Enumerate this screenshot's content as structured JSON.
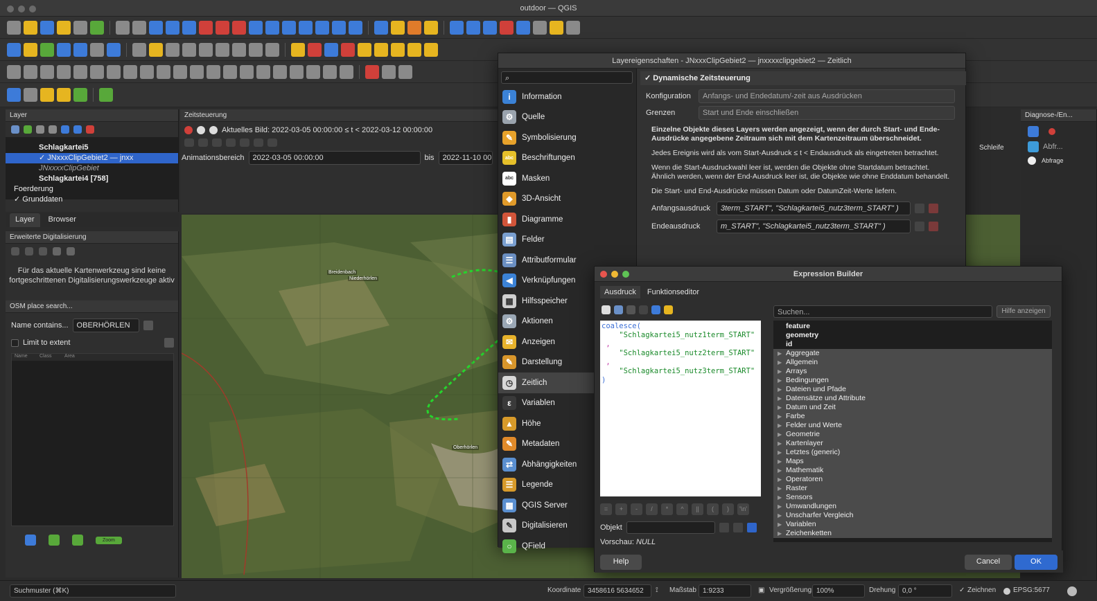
{
  "window": {
    "title": "outdoor — QGIS"
  },
  "toolbar_colors": {
    "blue": "#3d7bd9",
    "yellow": "#e6b520",
    "green": "#58a83a",
    "red": "#d0403a",
    "orange": "#e07b2a",
    "gray": "#8a8a8a"
  },
  "layer_panel": {
    "title": "Layer",
    "items": [
      {
        "label": "Schlagkartei5",
        "bold": true
      },
      {
        "label": "JNxxxClipGebiet2 — jnxx",
        "selected": true,
        "checked": "✓"
      },
      {
        "label": "JNxxxxClipGebiet",
        "italic": true
      },
      {
        "label": "Schlagkartei4 [758]",
        "bold": true
      },
      {
        "label": "Foerderung"
      },
      {
        "label": "Grunddaten",
        "checked": "✓"
      }
    ],
    "tabs": [
      "Layer",
      "Browser"
    ]
  },
  "digitizing_panel": {
    "title": "Erweiterte Digitalisierung",
    "message_line1": "Für das aktuelle Kartenwerkzeug sind keine",
    "message_line2": "fortgeschrittenen Digitalisierungswerkzeuge aktiv"
  },
  "osm_panel": {
    "title": "OSM place search...",
    "name_label": "Name contains...",
    "name_value": "OBERHÖRLEN",
    "limit_label": "Limit to extent",
    "columns": [
      "Name",
      "Class",
      "Area"
    ],
    "zoom_label": "Zoom"
  },
  "temporal_panel": {
    "title": "Zeitsteuerung",
    "current_frame": "Aktuelles Bild: 2022-03-05 00:00:00 ≤ t < 2022-03-12 00:00:00",
    "range_label": "Animationsbereich",
    "range_start": "2022-03-05 00:00:00",
    "range_to": "bis",
    "range_end": "2022-11-10 00"
  },
  "map": {
    "label_1": "Breidenbach",
    "label_2": "Oberhörlen",
    "label_3": "Niederhörlen"
  },
  "right_panel": {
    "title": "Diagnose-/En...",
    "loop_label": "Schleife",
    "search_placeholder": "Abfr...",
    "query_label": "Abfrage"
  },
  "layer_props": {
    "title": "Layereigenschaften - JNxxxClipGebiet2 — jnxxxxclipgebiet2 — Zeitlich",
    "nav": [
      {
        "label": "Information",
        "icon": "info-icon",
        "color": "#3b82d6",
        "glyph": "i"
      },
      {
        "label": "Quelle",
        "icon": "source-icon",
        "color": "#9aa3ad",
        "glyph": "⚙"
      },
      {
        "label": "Symbolisierung",
        "icon": "symbology-icon",
        "color": "#e7a22b",
        "glyph": "✎"
      },
      {
        "label": "Beschriftungen",
        "icon": "labels-icon",
        "color": "#e6c02a",
        "glyph": "abc"
      },
      {
        "label": "Masken",
        "icon": "masks-icon",
        "color": "#ffffff",
        "glyph": "abc"
      },
      {
        "label": "3D-Ansicht",
        "icon": "3d-view-icon",
        "color": "#e09a2a",
        "glyph": "◆"
      },
      {
        "label": "Diagramme",
        "icon": "diagrams-icon",
        "color": "#d2553a",
        "glyph": "▮"
      },
      {
        "label": "Felder",
        "icon": "fields-icon",
        "color": "#7a9fd0",
        "glyph": "▤"
      },
      {
        "label": "Attributformular",
        "icon": "attribute-form-icon",
        "color": "#6b8fc2",
        "glyph": "☰"
      },
      {
        "label": "Verknüpfungen",
        "icon": "joins-icon",
        "color": "#3b82d6",
        "glyph": "◀"
      },
      {
        "label": "Hilfsspeicher",
        "icon": "auxiliary-storage-icon",
        "color": "#cfcfcf",
        "glyph": "▦"
      },
      {
        "label": "Aktionen",
        "icon": "actions-icon",
        "color": "#9aa7b5",
        "glyph": "⚙"
      },
      {
        "label": "Anzeigen",
        "icon": "display-icon",
        "color": "#e7b22b",
        "glyph": "✉"
      },
      {
        "label": "Darstellung",
        "icon": "rendering-icon",
        "color": "#d8962b",
        "glyph": "✎"
      },
      {
        "label": "Zeitlich",
        "icon": "temporal-icon",
        "color": "#d8d8d8",
        "glyph": "◷",
        "selected": true
      },
      {
        "label": "Variablen",
        "icon": "variables-icon",
        "color": "#3a3a3a",
        "glyph": "ε"
      },
      {
        "label": "Höhe",
        "icon": "elevation-icon",
        "color": "#d79a2a",
        "glyph": "▲"
      },
      {
        "label": "Metadaten",
        "icon": "metadata-icon",
        "color": "#e08a2a",
        "glyph": "✎"
      },
      {
        "label": "Abhängigkeiten",
        "icon": "dependencies-icon",
        "color": "#5a8fd0",
        "glyph": "⇄"
      },
      {
        "label": "Legende",
        "icon": "legend-icon",
        "color": "#d79a2a",
        "glyph": "☰"
      },
      {
        "label": "QGIS Server",
        "icon": "qgis-server-icon",
        "color": "#5a8fd0",
        "glyph": "▦"
      },
      {
        "label": "Digitalisieren",
        "icon": "digitizing-icon",
        "color": "#c8c8c8",
        "glyph": "✎"
      },
      {
        "label": "QField",
        "icon": "qfield-icon",
        "color": "#5ab34a",
        "glyph": "○"
      }
    ],
    "dynamic_check": "✓",
    "dynamic_label": "Dynamische Zeitsteuerung",
    "config_label": "Konfiguration",
    "config_value": "Anfangs- und Endedatum/-zeit aus Ausdrücken",
    "limits_label": "Grenzen",
    "limits_value": "Start und Ende einschließen",
    "desc_bold": "Einzelne Objekte dieses Layers werden angezeigt, wenn der durch Start- und Ende-Ausdrücke angegebene Zeitraum sich mit dem Kartenzeitraum überschneidet.",
    "desc_2": "Jedes Ereignis wird als vom Start-Ausdruck ≤ t < Endausdruck als eingetreten betrachtet.",
    "desc_3": "Wenn die Start-Ausdruckwahl leer ist, werden die Objekte ohne Startdatum betrachtet. Ähnlich werden, wenn der End-Ausdruck leer ist, die Objekte wie ohne Enddatum behandelt.",
    "desc_4": "Die Start- und End-Ausdrücke müssen Datum oder DatumZeit-Werte liefern.",
    "start_expr_label": "Anfangsausdruck",
    "start_expr_value": "3term_START\",   \"Schlagkartei5_nutz3term_START\" )",
    "end_expr_label": "Endeausdruck",
    "end_expr_value": "m_START\",   \"Schlagkartei5_nutz3term_START\" )"
  },
  "expr_builder": {
    "title": "Expression Builder",
    "tabs": [
      "Ausdruck",
      "Funktionseditor"
    ],
    "code_lines": [
      "coalesce(",
      "    \"Schlagkartei5_nutz1term_START\"",
      " ,",
      "    \"Schlagkartei5_nutz2term_START\"",
      " ,",
      "    \"Schlagkartei5_nutz3term_START\"",
      ")"
    ],
    "search_placeholder": "Suchen...",
    "help_button": "Hilfe anzeigen",
    "top_items": [
      "feature",
      "geometry",
      "id"
    ],
    "groups": [
      "Aggregate",
      "Allgemein",
      "Arrays",
      "Bedingungen",
      "Dateien und Pfade",
      "Datensätze und Attribute",
      "Datum und Zeit",
      "Farbe",
      "Felder und Werte",
      "Geometrie",
      "Kartenlayer",
      "Letztes (generic)",
      "Maps",
      "Mathematik",
      "Operatoren",
      "Raster",
      "Sensors",
      "Umwandlungen",
      "Unscharfer Vergleich",
      "Variablen",
      "Zeichenketten"
    ],
    "operators": [
      "=",
      "+",
      "-",
      "/",
      "*",
      "^",
      "||",
      "(",
      ")",
      "'\\n'"
    ],
    "object_label": "Objekt",
    "preview_label": "Vorschau:",
    "preview_value": "NULL",
    "help_label": "Help",
    "cancel_label": "Cancel",
    "ok_label": "OK"
  },
  "statusbar": {
    "search_placeholder": "Suchmuster (⌘K)",
    "coord_label": "Koordinate",
    "coord_value": "3458616 5634652",
    "scale_label": "Maßstab",
    "scale_value": "1:9233",
    "magnifier_label": "Vergrößerung",
    "magnifier_value": "100%",
    "rotation_label": "Drehung",
    "rotation_value": "0,0 °",
    "render_check": "✓",
    "render_label": "Zeichnen",
    "crs_label": "EPSG:5677"
  }
}
